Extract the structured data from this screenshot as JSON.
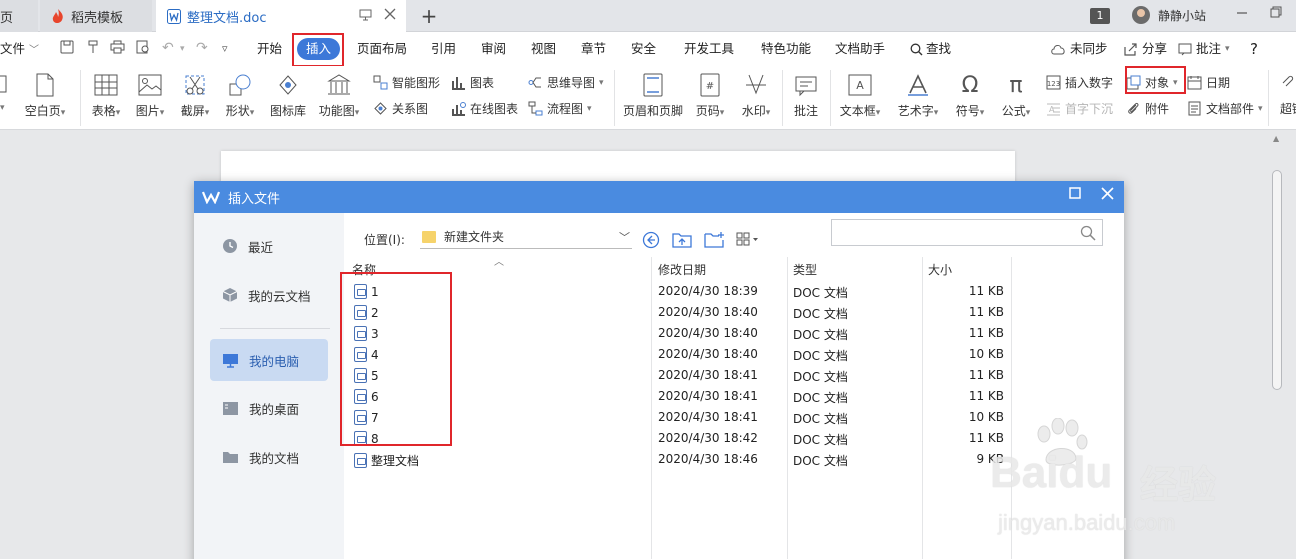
{
  "tabs": {
    "home_partial": "页",
    "docer": "稻壳模板",
    "current_doc": "整理文档.doc"
  },
  "titlebar": {
    "page_badge": "1",
    "user_name": "静静小站"
  },
  "menu": {
    "file": "文件",
    "items": [
      "开始",
      "插入",
      "页面布局",
      "引用",
      "审阅",
      "视图",
      "章节",
      "安全",
      "开发工具",
      "特色功能",
      "文档助手",
      "查找"
    ],
    "sync": "未同步",
    "share": "分享",
    "comment": "批注",
    "help": "?"
  },
  "ribbon": {
    "blank_page": "空白页",
    "table": "表格",
    "picture": "图片",
    "screenshot": "截屏",
    "shape": "形状",
    "icon_lib": "图标库",
    "func_chart": "功能图",
    "smart_shape": "智能图形",
    "chart": "图表",
    "mind_map": "思维导图",
    "relation": "关系图",
    "online_chart": "在线图表",
    "flowchart": "流程图",
    "header_footer": "页眉和页脚",
    "page_num": "页码",
    "watermark": "水印",
    "annotation": "批注",
    "textbox": "文本框",
    "wordart": "艺术字",
    "symbol": "符号",
    "formula": "公式",
    "insert_number": "插入数字",
    "drop_cap": "首字下沉",
    "object": "对象",
    "attachment": "附件",
    "date": "日期",
    "doc_parts": "文档部件",
    "super_partial": "超链"
  },
  "dialog": {
    "title": "插入文件",
    "sidebar": [
      "最近",
      "我的云文档",
      "我的电脑",
      "我的桌面",
      "我的文档"
    ],
    "location_label": "位置(I):",
    "location_value": "新建文件夹",
    "search_placeholder": "",
    "columns": [
      "名称",
      "修改日期",
      "类型",
      "大小"
    ],
    "files": [
      {
        "name": "1",
        "date": "2020/4/30 18:39",
        "type": "DOC 文档",
        "size": "11 KB"
      },
      {
        "name": "2",
        "date": "2020/4/30 18:40",
        "type": "DOC 文档",
        "size": "11 KB"
      },
      {
        "name": "3",
        "date": "2020/4/30 18:40",
        "type": "DOC 文档",
        "size": "11 KB"
      },
      {
        "name": "4",
        "date": "2020/4/30 18:40",
        "type": "DOC 文档",
        "size": "10 KB"
      },
      {
        "name": "5",
        "date": "2020/4/30 18:41",
        "type": "DOC 文档",
        "size": "11 KB"
      },
      {
        "name": "6",
        "date": "2020/4/30 18:41",
        "type": "DOC 文档",
        "size": "11 KB"
      },
      {
        "name": "7",
        "date": "2020/4/30 18:41",
        "type": "DOC 文档",
        "size": "10 KB"
      },
      {
        "name": "8",
        "date": "2020/4/30 18:42",
        "type": "DOC 文档",
        "size": "11 KB"
      },
      {
        "name": "整理文档",
        "date": "2020/4/30 18:46",
        "type": "DOC 文档",
        "size": "9 KB"
      }
    ]
  },
  "watermark": {
    "brand": "Baidu",
    "cn": "经验",
    "url": "jingyan.baidu.com"
  },
  "colors": {
    "accent": "#3d78d8",
    "dialog_title": "#4a8be0",
    "highlight_box": "#e0262b"
  }
}
